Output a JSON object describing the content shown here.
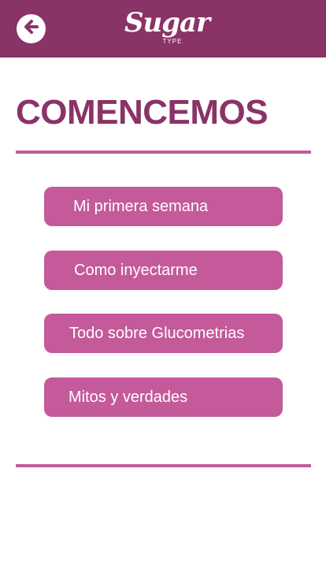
{
  "header": {
    "logo_text": "Sugar",
    "logo_sub": "TYPE",
    "back_icon": "arrow-left-icon"
  },
  "main": {
    "title": "COMENCEMOS",
    "menu": [
      {
        "label": "Mi primera semana"
      },
      {
        "label": "Como inyectarme"
      },
      {
        "label": "Todo sobre Glucometrias"
      },
      {
        "label": "Mitos y verdades"
      }
    ]
  },
  "colors": {
    "header_bg": "#8a3366",
    "title": "#8a3366",
    "button_bg": "#c45a9a",
    "divider": "#c45a9a"
  }
}
